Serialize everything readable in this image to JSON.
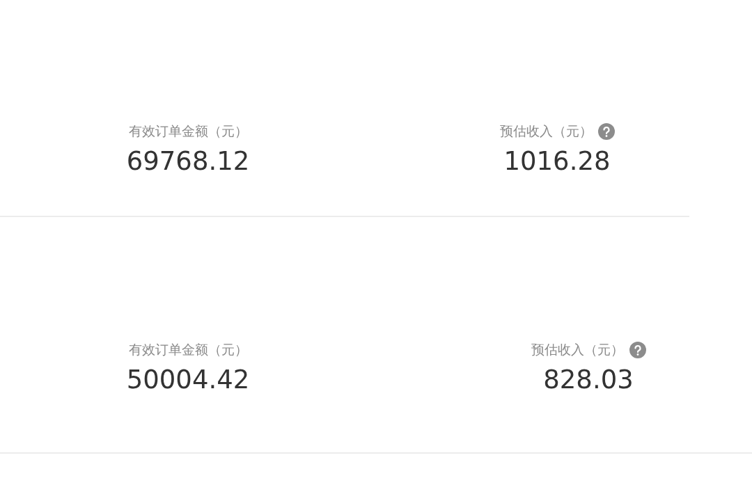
{
  "cards": [
    {
      "stats": [
        {
          "label": "有效订单金额（元）",
          "value": "69768.12",
          "help": false
        },
        {
          "label": "预估收入（元）",
          "value": "1016.28",
          "help": true
        }
      ]
    },
    {
      "stats": [
        {
          "label": "有效订单金额（元）",
          "value": "50004.42",
          "help": false
        },
        {
          "label": "预估收入（元）",
          "value": "828.03",
          "help": true
        }
      ]
    }
  ]
}
